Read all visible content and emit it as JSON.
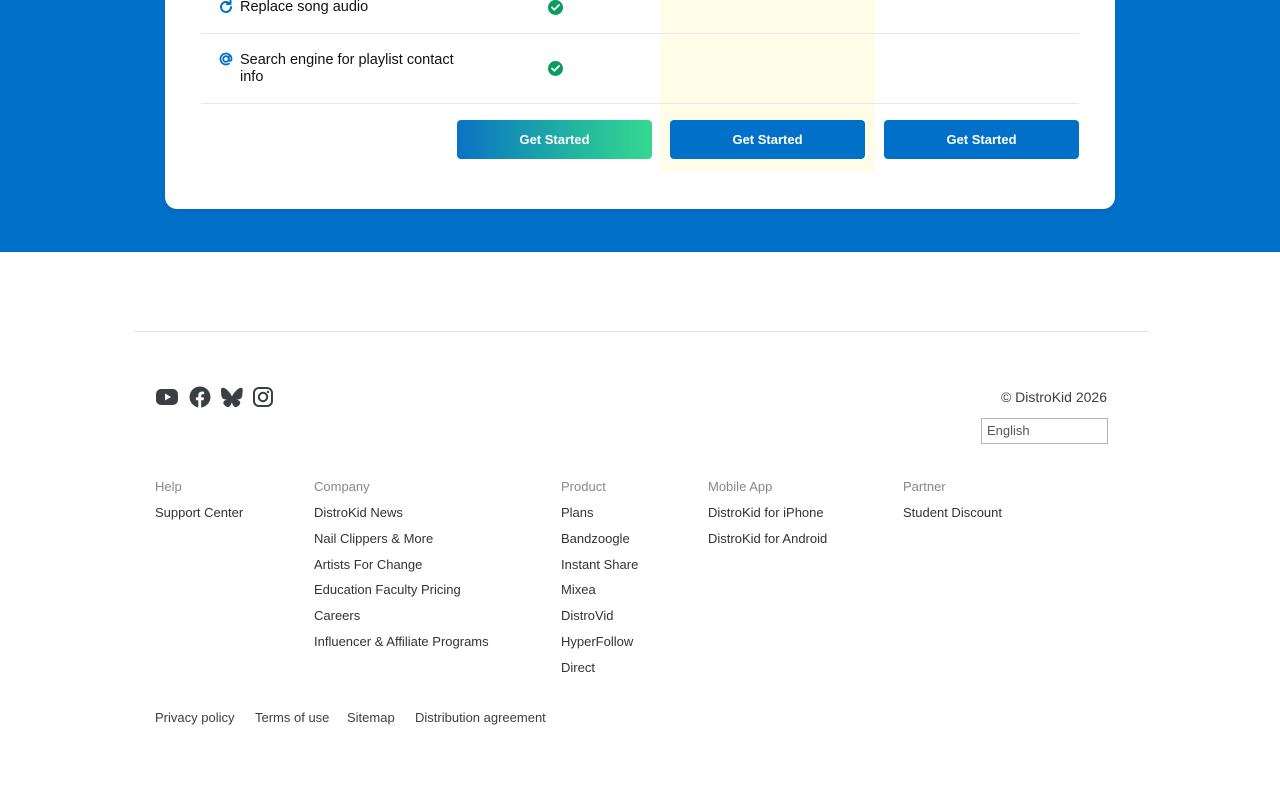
{
  "features": [
    {
      "label": "Replace song audio",
      "icon": "refresh-icon"
    },
    {
      "label": "Search engine for playlist contact info",
      "icon": "at-sign-icon"
    }
  ],
  "buttons": [
    "Get Started",
    "Get Started",
    "Get Started"
  ],
  "colors": {
    "brand_blue": "#0070c9",
    "check_green": "#0d9b61",
    "highlight": "#fffce8"
  },
  "social_icons": [
    "youtube-icon",
    "facebook-icon",
    "bluesky-icon",
    "instagram-icon"
  ],
  "copyright": "© DistroKid 2026",
  "language": "English",
  "footer": {
    "help": {
      "heading": "Help",
      "links": [
        "Support Center"
      ]
    },
    "company": {
      "heading": "Company",
      "links": [
        "DistroKid News",
        "Nail Clippers & More",
        "Artists For Change",
        "Education Faculty Pricing",
        "Careers",
        "Influencer & Affiliate Programs"
      ]
    },
    "product": {
      "heading": "Product",
      "links": [
        "Plans",
        "Bandzoogle",
        "Instant Share",
        "Mixea",
        "DistroVid",
        "HyperFollow",
        "Direct"
      ]
    },
    "mobile": {
      "heading": "Mobile App",
      "links": [
        "DistroKid for iPhone",
        "DistroKid for Android"
      ]
    },
    "partner": {
      "heading": "Partner",
      "links": [
        "Student Discount"
      ]
    }
  },
  "legal": [
    "Privacy policy",
    "Terms of use",
    "Sitemap",
    "Distribution agreement"
  ]
}
